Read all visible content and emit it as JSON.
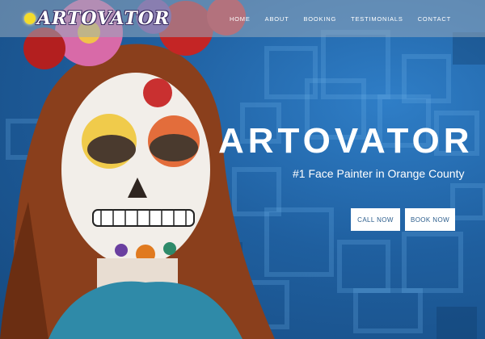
{
  "brand": {
    "logo_text": "ARTOVATOR"
  },
  "nav": {
    "items": [
      {
        "label": "HOME"
      },
      {
        "label": "ABOUT"
      },
      {
        "label": "BOOKING"
      },
      {
        "label": "TESTIMONIALS"
      },
      {
        "label": "CONTACT"
      }
    ]
  },
  "hero": {
    "title": "ARTOVATOR",
    "subtitle": "#1 Face Painter in Orange County",
    "call_label": "CALL NOW",
    "book_label": "BOOK NOW",
    "background_color": "#1f5f9f",
    "text_color": "#ffffff"
  },
  "icons": [
    "lightbulb-icon"
  ]
}
